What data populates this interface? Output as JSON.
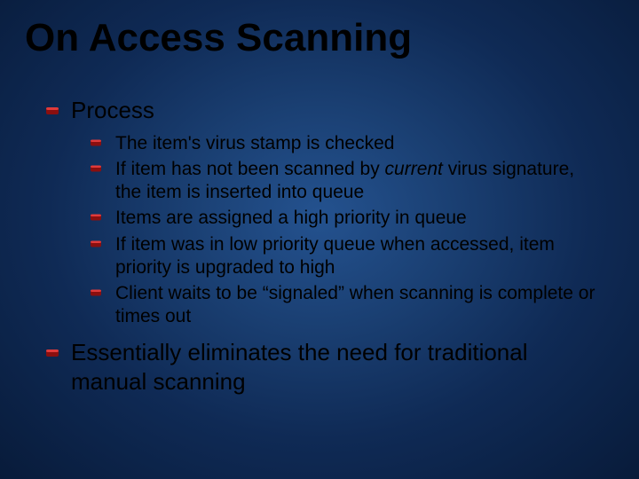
{
  "title": "On Access Scanning",
  "lvl1a": "Process",
  "sub1": "The item's virus stamp is checked",
  "sub2a": "If item has not been scanned by ",
  "sub2b": "current",
  "sub2c": " virus signature, the item is inserted into queue",
  "sub3": "Items are assigned a high priority in queue",
  "sub4": "If item was in low priority queue when accessed, item priority is upgraded to high",
  "sub5": "Client waits to be “signaled” when scanning is complete or times out",
  "lvl1b": "Essentially eliminates the need for traditional manual scanning"
}
